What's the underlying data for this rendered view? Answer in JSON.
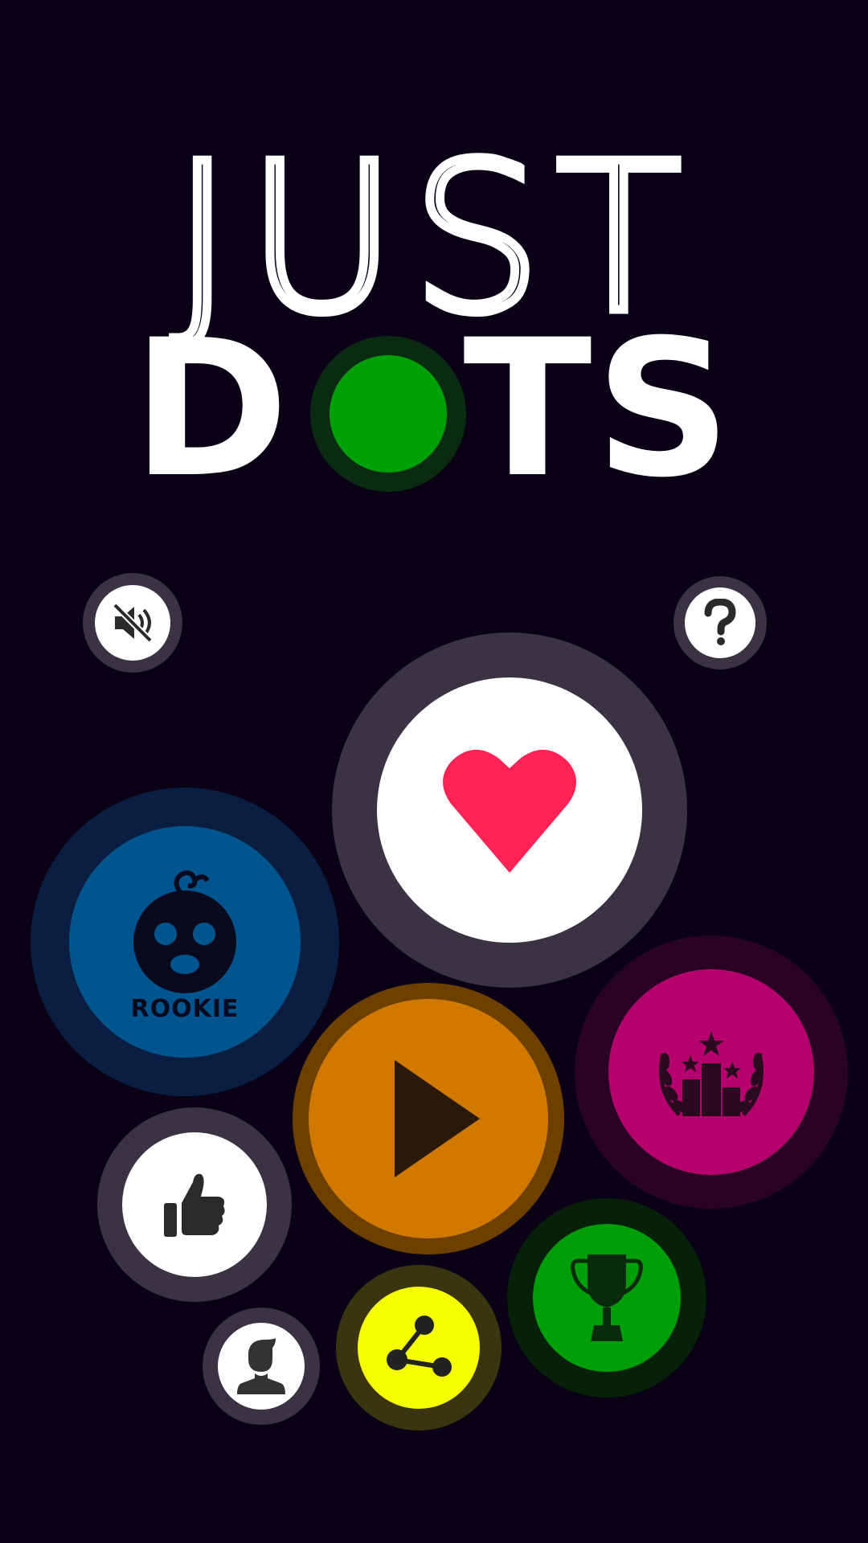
{
  "app": {
    "logo_line1": "JUST",
    "logo_line2_left": "D",
    "logo_line2_right": "TS"
  },
  "buttons": {
    "mute": {
      "icon": "sound-muted-icon"
    },
    "help": {
      "icon": "question-mark-icon"
    },
    "favorite": {
      "icon": "heart-icon"
    },
    "rank": {
      "icon": "baby-face-icon",
      "label": "ROOKIE"
    },
    "play": {
      "icon": "play-icon"
    },
    "leaderboard": {
      "icon": "podium-laurel-icon"
    },
    "like": {
      "icon": "thumbs-up-icon"
    },
    "achievements": {
      "icon": "trophy-icon"
    },
    "share": {
      "icon": "share-icon"
    },
    "profile": {
      "icon": "user-avatar-icon"
    }
  },
  "colors": {
    "background": "#0a0117",
    "logo_dot": "#00a008",
    "heart": "#ff2255",
    "rank_blue": "#00558f",
    "play_orange": "#d07800",
    "leaderboard_magenta": "#b5006e",
    "trophy_green": "#009e08",
    "share_yellow": "#f5ff00",
    "ring_grey": "#3b3343"
  }
}
